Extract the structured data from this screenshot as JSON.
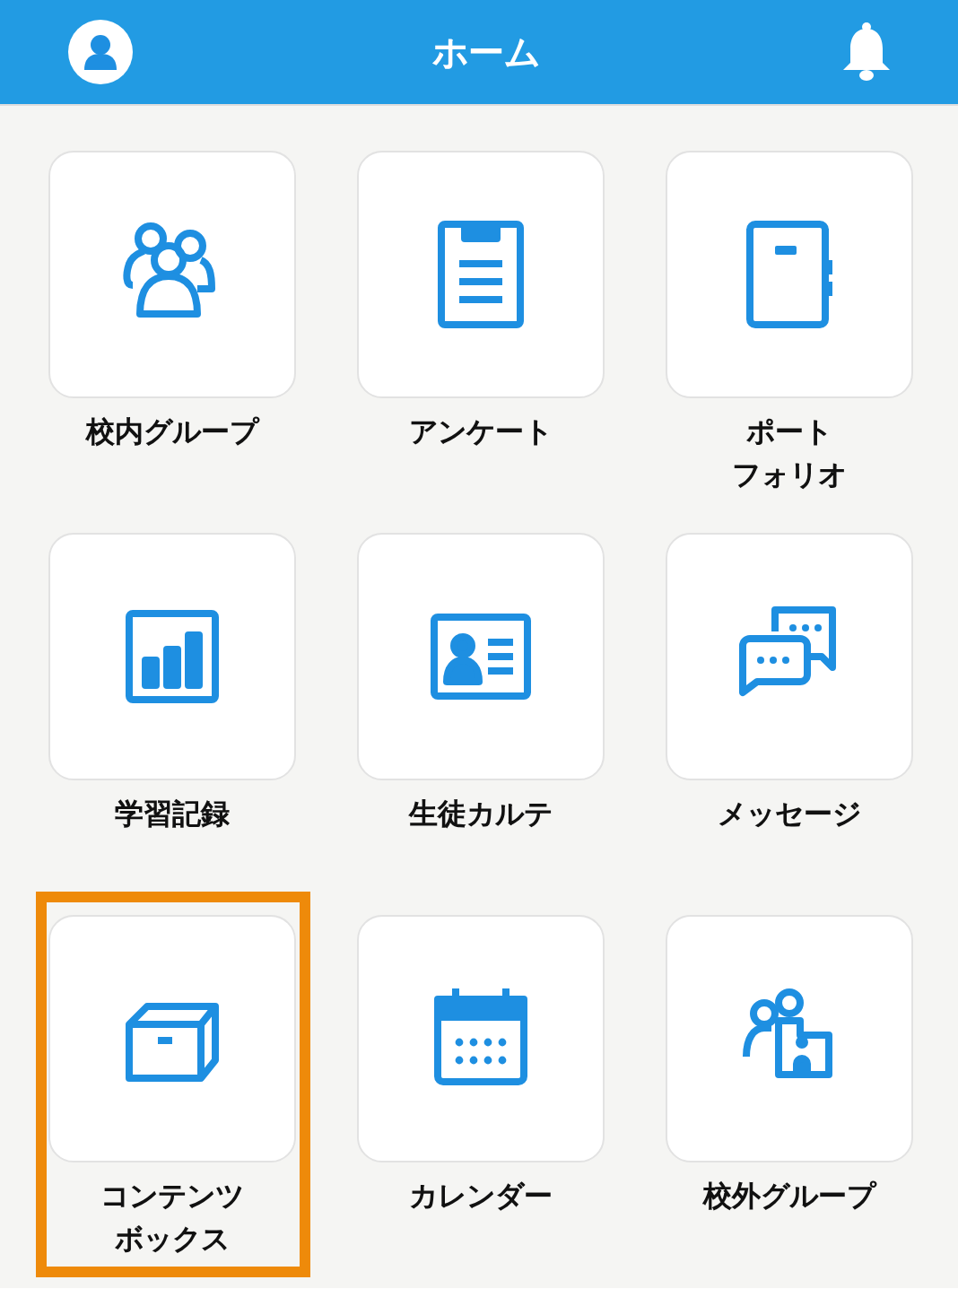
{
  "header": {
    "title": "ホーム"
  },
  "menu": [
    {
      "lines": [
        "校内グループ"
      ],
      "selected": false
    },
    {
      "lines": [
        "アンケート"
      ],
      "selected": false
    },
    {
      "lines": [
        "ポート",
        "フォリオ"
      ],
      "selected": false
    },
    {
      "lines": [
        "学習記録"
      ],
      "selected": false
    },
    {
      "lines": [
        "生徒カルテ"
      ],
      "selected": false
    },
    {
      "lines": [
        "メッセージ"
      ],
      "selected": false
    },
    {
      "lines": [
        "コンテンツ",
        "ボックス"
      ],
      "selected": true
    },
    {
      "lines": [
        "カレンダー"
      ],
      "selected": false
    },
    {
      "lines": [
        "校外グループ"
      ],
      "selected": false
    }
  ]
}
